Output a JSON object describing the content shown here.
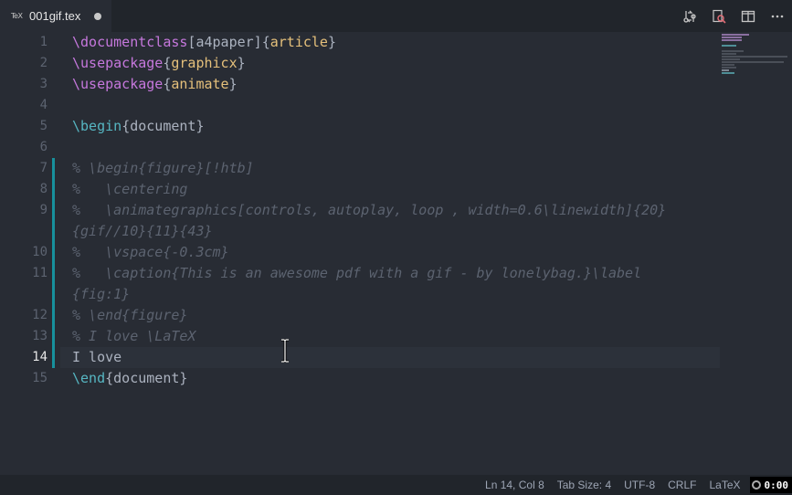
{
  "tab": {
    "icon": "TeX",
    "filename": "001gif.tex"
  },
  "actions": [
    "source-control-diff-icon",
    "search-preview-icon",
    "split-editor-icon",
    "more-actions-icon"
  ],
  "editor": {
    "current_line": 14,
    "line_numbers": [
      "1",
      "2",
      "3",
      "4",
      "5",
      "6",
      "7",
      "8",
      "9",
      "10",
      "11",
      "12",
      "13",
      "14",
      "15"
    ],
    "lines": {
      "l1": {
        "cmd": "\\documentclass",
        "opt": "[a4paper]",
        "ob": "{",
        "arg": "article",
        "cb": "}"
      },
      "l2": {
        "cmd": "\\usepackage",
        "ob": "{",
        "arg": "graphicx",
        "cb": "}"
      },
      "l3": {
        "cmd": "\\usepackage",
        "ob": "{",
        "arg": "animate",
        "cb": "}"
      },
      "l5": {
        "cmd": "\\begin",
        "rest": "{document}"
      },
      "l7": "% \\begin{figure}[!htb]",
      "l8": "%   \\centering",
      "l9a": "%   \\animategraphics[controls, autoplay, loop , width=0.6\\linewidth]{20}",
      "l9b": "{gif//10}{11}{43}",
      "l10": "%   \\vspace{-0.3cm}",
      "l11a": "%   \\caption{This is an awesome pdf with a gif - by lonelybag.}\\label",
      "l11b": "{fig:1}",
      "l12": "% \\end{figure}",
      "l13": "% I love \\LaTeX",
      "l14": "I love",
      "l15": {
        "cmd": "\\end",
        "rest": "{document}"
      }
    }
  },
  "status": {
    "position": "Ln 14, Col 8",
    "tab_size": "Tab Size: 4",
    "encoding": "UTF-8",
    "eol": "CRLF",
    "language": "LaTeX",
    "timer": "0:00"
  },
  "colors": {
    "background": "#282c34",
    "command": "#56b6c2",
    "keyword": "#c678dd",
    "argument": "#e5c07b",
    "comment": "#5c6370",
    "git_modified": "#17919c"
  }
}
